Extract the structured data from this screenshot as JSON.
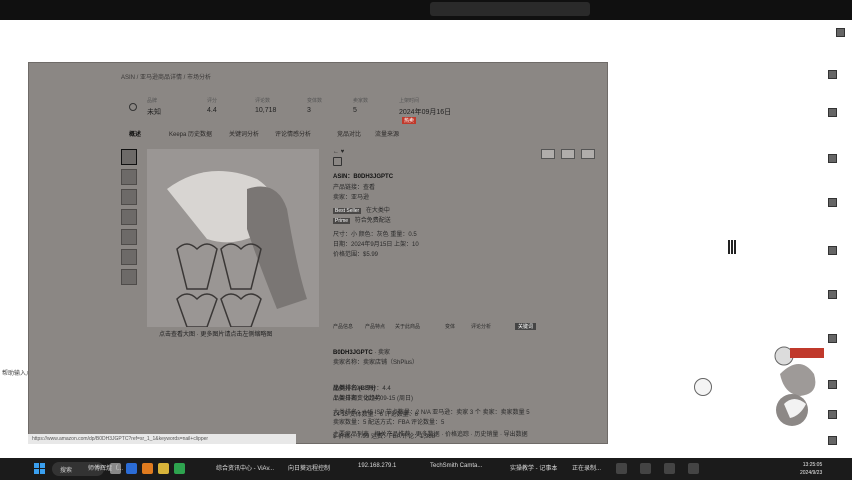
{
  "remote": {
    "crumb": "ASIN / 亚马逊商品详情 / 市场分析",
    "stats": [
      {
        "label": "品牌",
        "value": "未知"
      },
      {
        "label": "评分",
        "value": "4.4"
      },
      {
        "label": "评论数",
        "value": "10,718"
      },
      {
        "label": "变体数",
        "value": "3"
      },
      {
        "label": "卖家数",
        "value": "5"
      },
      {
        "label": "上架时间",
        "value": "2024年09月16日",
        "badge": "热卖"
      }
    ],
    "tabs": [
      "概述",
      "Keepa 历史数据",
      "关键词分析",
      "评论情感分析",
      "竞品对比",
      "流量来源"
    ],
    "image_caption": "点击查看大图 · 更多图片请点击左侧缩略图",
    "detail": {
      "asin_label": "ASIN：",
      "asin": "B0DH3JGPTC",
      "link1": "产品链接：查看",
      "link2": "卖家：亚马逊",
      "chip1": "Best Seller",
      "chip1_text": "  在大类中",
      "chip2": "Prime",
      "chip2_text": " 符合免费配送",
      "spec1": "尺寸：小  颜色：灰色  重量：0.5",
      "spec2": "日期：2024年9月15日  上架：10",
      "spec3": "价格范围：$5.99",
      "filters": [
        "产品信息",
        "产品特点",
        "关于此商品",
        "变体",
        "评论分析",
        "关键词"
      ],
      "asin2": "B0DH3JGPTC",
      "asin2_suffix": "· 卖家",
      "seller": "卖家名称：卖家店铺（ShPlus）",
      "section_title": "品类排名 (BSR)",
      "section_sub": "品类排名变化趋势",
      "line_a": "大类排名：#45    ISP 节点数量：2    N/A    亚马逊：卖家 3 个    卖家：卖家数量 5",
      "line_b": "卖家数量：5    配送方式：FBA    评论数量：5",
      "price_row": "$ 价格：  7.99   运费：FBA    评论：1,988",
      "ratio_row": "比例：1.94    评分：4.4",
      "date_row": "上架日期：  2024-09-15  (周日)",
      "bottom_row": "14    15     变体数量：6     评论数量：6"
    },
    "bottom_links": "主要竞品列表 · 相关产品推荐 · 更多数据 · 价格追踪 · 历史销量 · 导出数据",
    "url": "https://www.amazon.com/dp/B0DH3JGPTC?ref=sr_1_1&keywords=nail+clipper"
  },
  "desktop_left_text": "帮助输入点",
  "taskbar": {
    "search_placeholder": "搜索",
    "apps": [
      "师傅辉煌（...",
      "综合资讯中心 - ViAv...",
      "向日葵远程控制",
      "192.168.279.1",
      "TechSmith Camta...",
      "实操教学 - 记事本",
      "正在录制..."
    ],
    "time": "13:25:05",
    "date": "2024/9/23"
  },
  "colors": {
    "remote_bg": "#8b8784",
    "taskbar_bg": "#1b1b1b",
    "accent_red": "#c0392b"
  }
}
